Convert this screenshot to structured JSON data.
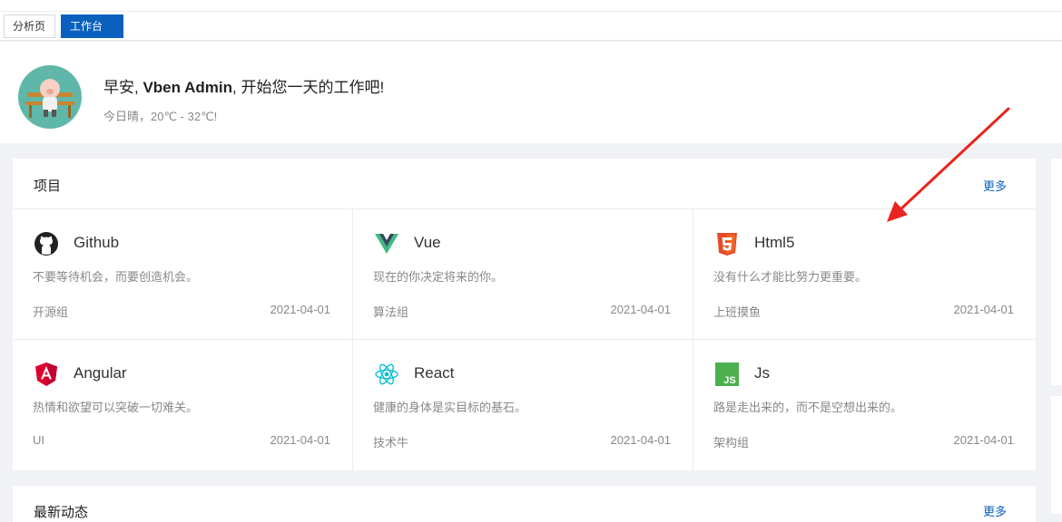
{
  "tabs": [
    {
      "label": "分析页"
    },
    {
      "label": "工作台",
      "close": "×"
    }
  ],
  "header": {
    "greeting_prefix": "早安, ",
    "user": "Vben Admin",
    "greeting_suffix": ", 开始您一天的工作吧!",
    "weather": "今日晴，20℃ - 32℃!"
  },
  "projects": {
    "title": "项目",
    "more": "更多",
    "items": [
      {
        "name": "Github",
        "desc": "不要等待机会，而要创造机会。",
        "group": "开源组",
        "date": "2021-04-01",
        "icon": "github-icon",
        "color": "#222222"
      },
      {
        "name": "Vue",
        "desc": "现在的你决定将来的你。",
        "group": "算法组",
        "date": "2021-04-01",
        "icon": "vue-icon",
        "color": "#42b883"
      },
      {
        "name": "Html5",
        "desc": "没有什么才能比努力更重要。",
        "group": "上班摸鱼",
        "date": "2021-04-01",
        "icon": "html5-icon",
        "color": "#e44d26"
      },
      {
        "name": "Angular",
        "desc": "热情和欲望可以突破一切难关。",
        "group": "UI",
        "date": "2021-04-01",
        "icon": "angular-icon",
        "color": "#bf0d2c"
      },
      {
        "name": "React",
        "desc": "健康的身体是实目标的基石。",
        "group": "技术牛",
        "date": "2021-04-01",
        "icon": "react-icon",
        "color": "#00d8ff"
      },
      {
        "name": "Js",
        "desc": "路是走出来的，而不是空想出来的。",
        "group": "架构组",
        "date": "2021-04-01",
        "icon": "js-icon",
        "color": "#4caf50"
      }
    ]
  },
  "dynamic": {
    "title": "最新动态",
    "more": "更多"
  },
  "accent": "#0960bd"
}
